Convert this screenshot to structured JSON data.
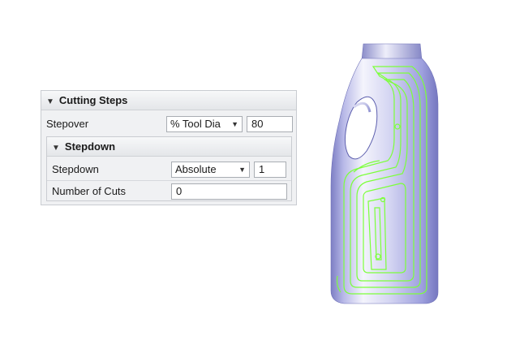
{
  "cutting_steps": {
    "title": "Cutting Steps",
    "stepover_label": "Stepover",
    "stepover_mode": "% Tool Dia",
    "stepover_value": "80"
  },
  "stepdown": {
    "title": "Stepdown",
    "stepdown_label": "Stepdown",
    "stepdown_mode": "Absolute",
    "stepdown_value": "1",
    "cuts_label": "Number of Cuts",
    "cuts_value": "0"
  },
  "colors": {
    "toolpath": "#7cff3a",
    "model": "#9ea0de"
  },
  "icons": {
    "collapse": "collapse-triangle-icon",
    "dropdown": "dropdown-arrow-icon"
  }
}
